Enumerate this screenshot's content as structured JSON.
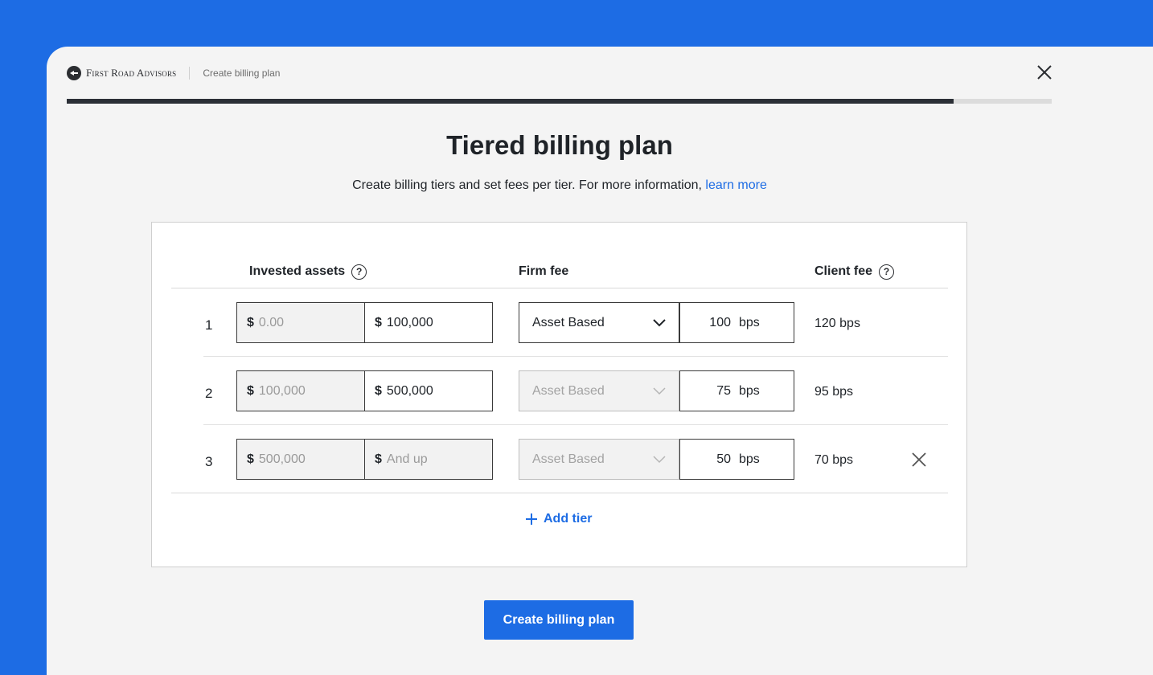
{
  "header": {
    "brand": "First Road Advisors",
    "breadcrumb": "Create billing plan",
    "progress_percent": 90
  },
  "page": {
    "title": "Tiered billing plan",
    "subtitle": "Create billing tiers and set fees per tier. For more information,",
    "learn_more": "learn more"
  },
  "table": {
    "headers": {
      "invested_assets": "Invested assets",
      "firm_fee": "Firm fee",
      "client_fee": "Client fee",
      "help": "?"
    },
    "currency": "$",
    "tiers": [
      {
        "num": "1",
        "from": "0.00",
        "to": "100,000",
        "fee_type": "Asset Based",
        "firm_fee": "100",
        "unit": "bps",
        "client_fee": "120 bps"
      },
      {
        "num": "2",
        "from": "100,000",
        "to": "500,000",
        "fee_type": "Asset Based",
        "firm_fee": "75",
        "unit": "bps",
        "client_fee": "95 bps"
      },
      {
        "num": "3",
        "from": "500,000",
        "to": "And up",
        "fee_type": "Asset Based",
        "firm_fee": "50",
        "unit": "bps",
        "client_fee": "70 bps"
      }
    ],
    "add_tier": "Add tier"
  },
  "actions": {
    "create": "Create billing plan"
  },
  "colors": {
    "accent": "#1d6ce4",
    "progress": "#2b2f36"
  }
}
